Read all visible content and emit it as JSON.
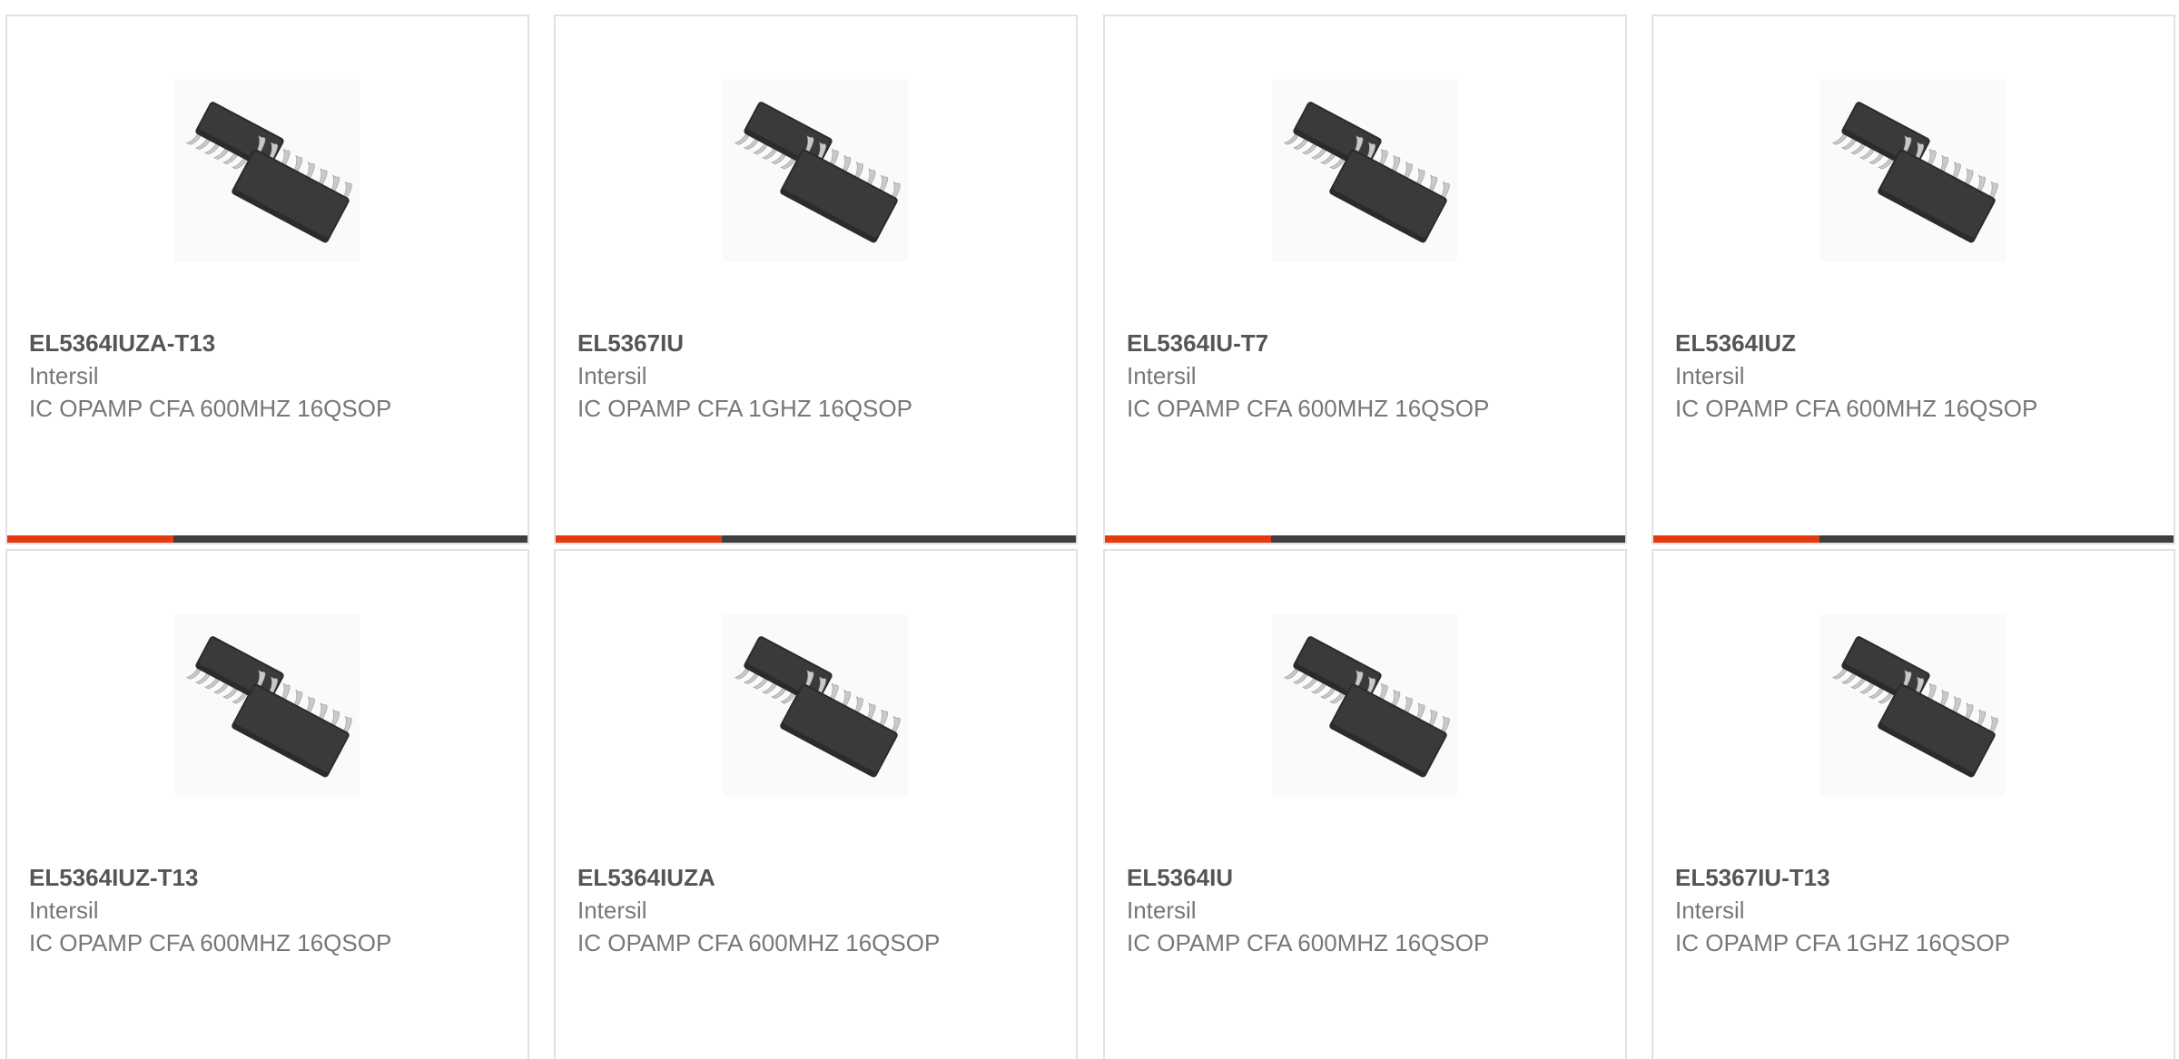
{
  "colors": {
    "accent": "#e63b10",
    "bar": "#3e3e3e",
    "border": "#e2e2e2",
    "text": "#777777",
    "part": "#555555"
  },
  "products": [
    {
      "part": "EL5364IUZA-T13",
      "manufacturer": "Intersil",
      "description": "IC OPAMP CFA 600MHZ 16QSOP",
      "image_icon": "ic-chip-icon"
    },
    {
      "part": "EL5367IU",
      "manufacturer": "Intersil",
      "description": "IC OPAMP CFA 1GHZ 16QSOP",
      "image_icon": "ic-chip-icon"
    },
    {
      "part": "EL5364IU-T7",
      "manufacturer": "Intersil",
      "description": "IC OPAMP CFA 600MHZ 16QSOP",
      "image_icon": "ic-chip-icon"
    },
    {
      "part": "EL5364IUZ",
      "manufacturer": "Intersil",
      "description": "IC OPAMP CFA 600MHZ 16QSOP",
      "image_icon": "ic-chip-icon"
    },
    {
      "part": "EL5364IUZ-T13",
      "manufacturer": "Intersil",
      "description": "IC OPAMP CFA 600MHZ 16QSOP",
      "image_icon": "ic-chip-icon"
    },
    {
      "part": "EL5364IUZA",
      "manufacturer": "Intersil",
      "description": "IC OPAMP CFA 600MHZ 16QSOP",
      "image_icon": "ic-chip-icon"
    },
    {
      "part": "EL5364IU",
      "manufacturer": "Intersil",
      "description": "IC OPAMP CFA 600MHZ 16QSOP",
      "image_icon": "ic-chip-icon"
    },
    {
      "part": "EL5367IU-T13",
      "manufacturer": "Intersil",
      "description": "IC OPAMP CFA 1GHZ 16QSOP",
      "image_icon": "ic-chip-icon"
    }
  ]
}
